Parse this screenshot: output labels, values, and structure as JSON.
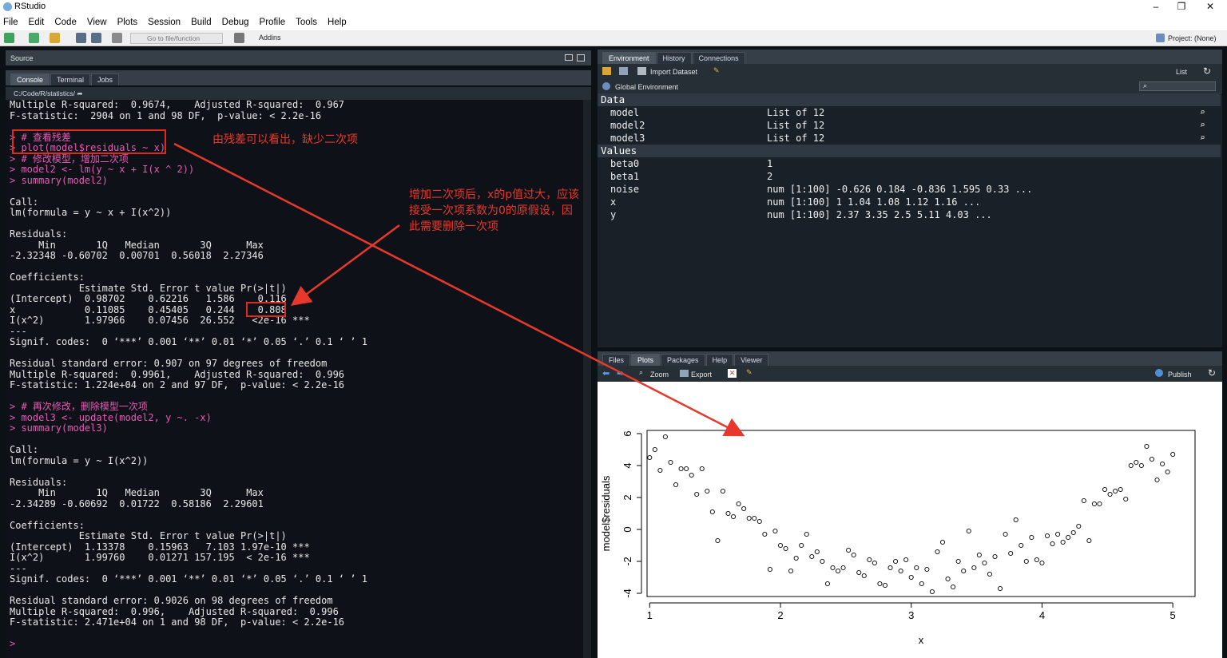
{
  "app": {
    "title": "RStudio"
  },
  "menu": [
    "File",
    "Edit",
    "Code",
    "View",
    "Plots",
    "Session",
    "Build",
    "Debug",
    "Profile",
    "Tools",
    "Help"
  ],
  "toolbar": {
    "goto": "Go to file/function",
    "addins": "Addins",
    "project": "Project: (None)"
  },
  "source": {
    "label": "Source"
  },
  "console_tabs": [
    "Console",
    "Terminal",
    "Jobs"
  ],
  "console_path": "C:/Code/R/statistics/",
  "console_lines": [
    {
      "t": "Multiple R-squared:  0.9674,\tAdjusted R-squared:  0.967 ",
      "c": "out"
    },
    {
      "t": "F-statistic:  2904 on 1 and 98 DF,  p-value: < 2.2e-16",
      "c": "out"
    },
    {
      "t": "",
      "c": "out"
    },
    {
      "t": "> # 查看残差",
      "c": "cmd"
    },
    {
      "t": "> plot(model$residuals ~ x)",
      "c": "cmd"
    },
    {
      "t": "> # 修改模型，增加二次项",
      "c": "cmd"
    },
    {
      "t": "> model2 <- lm(y ~ x + I(x ^ 2))",
      "c": "cmd"
    },
    {
      "t": "> summary(model2)",
      "c": "cmd"
    },
    {
      "t": "",
      "c": "out"
    },
    {
      "t": "Call:",
      "c": "out"
    },
    {
      "t": "lm(formula = y ~ x + I(x^2))",
      "c": "out"
    },
    {
      "t": "",
      "c": "out"
    },
    {
      "t": "Residuals:",
      "c": "out"
    },
    {
      "t": "     Min       1Q   Median       3Q      Max ",
      "c": "out"
    },
    {
      "t": "-2.32348 -0.60702  0.00701  0.56018  2.27346 ",
      "c": "out"
    },
    {
      "t": "",
      "c": "out"
    },
    {
      "t": "Coefficients:",
      "c": "out"
    },
    {
      "t": "            Estimate Std. Error t value Pr(>|t|)    ",
      "c": "out"
    },
    {
      "t": "(Intercept)  0.98702    0.62216   1.586    0.116    ",
      "c": "out"
    },
    {
      "t": "x            0.11085    0.45405   0.244    0.808    ",
      "c": "out"
    },
    {
      "t": "I(x^2)       1.97966    0.07456  26.552   <2e-16 ***",
      "c": "out"
    },
    {
      "t": "---",
      "c": "out"
    },
    {
      "t": "Signif. codes:  0 ‘***’ 0.001 ‘**’ 0.01 ‘*’ 0.05 ‘.’ 0.1 ‘ ’ 1",
      "c": "out"
    },
    {
      "t": "",
      "c": "out"
    },
    {
      "t": "Residual standard error: 0.907 on 97 degrees of freedom",
      "c": "out"
    },
    {
      "t": "Multiple R-squared:  0.9961,\tAdjusted R-squared:  0.996 ",
      "c": "out"
    },
    {
      "t": "F-statistic: 1.224e+04 on 2 and 97 DF,  p-value: < 2.2e-16",
      "c": "out"
    },
    {
      "t": "",
      "c": "out"
    },
    {
      "t": "> # 再次修改，删除模型一次项",
      "c": "cmd"
    },
    {
      "t": "> model3 <- update(model2, y ~. -x)",
      "c": "cmd"
    },
    {
      "t": "> summary(model3)",
      "c": "cmd"
    },
    {
      "t": "",
      "c": "out"
    },
    {
      "t": "Call:",
      "c": "out"
    },
    {
      "t": "lm(formula = y ~ I(x^2))",
      "c": "out"
    },
    {
      "t": "",
      "c": "out"
    },
    {
      "t": "Residuals:",
      "c": "out"
    },
    {
      "t": "     Min       1Q   Median       3Q      Max ",
      "c": "out"
    },
    {
      "t": "-2.34289 -0.60692  0.01722  0.58186  2.29601 ",
      "c": "out"
    },
    {
      "t": "",
      "c": "out"
    },
    {
      "t": "Coefficients:",
      "c": "out"
    },
    {
      "t": "            Estimate Std. Error t value Pr(>|t|)    ",
      "c": "out"
    },
    {
      "t": "(Intercept)  1.13378    0.15963   7.103 1.97e-10 ***",
      "c": "out"
    },
    {
      "t": "I(x^2)       1.99760    0.01271 157.195  < 2e-16 ***",
      "c": "out"
    },
    {
      "t": "---",
      "c": "out"
    },
    {
      "t": "Signif. codes:  0 ‘***’ 0.001 ‘**’ 0.01 ‘*’ 0.05 ‘.’ 0.1 ‘ ’ 1",
      "c": "out"
    },
    {
      "t": "",
      "c": "out"
    },
    {
      "t": "Residual standard error: 0.9026 on 98 degrees of freedom",
      "c": "out"
    },
    {
      "t": "Multiple R-squared:  0.996,\tAdjusted R-squared:  0.996 ",
      "c": "out"
    },
    {
      "t": "F-statistic: 2.471e+04 on 1 and 98 DF,  p-value: < 2.2e-16",
      "c": "out"
    },
    {
      "t": "",
      "c": "out"
    },
    {
      "t": "> ",
      "c": "cmd"
    }
  ],
  "annotations": {
    "note1": "由残差可以看出，缺少二次项",
    "note2": "增加二次项后，x的p值过大，应该接受一次项系数为0的原假设，因此需要删除一次项"
  },
  "env": {
    "tabs": [
      "Environment",
      "History",
      "Connections"
    ],
    "import": "Import Dataset",
    "list": "List",
    "global": "Global Environment",
    "data_header": "Data",
    "values_header": "Values",
    "data": [
      {
        "name": "model",
        "value": "List of 12"
      },
      {
        "name": "model2",
        "value": "List of 12"
      },
      {
        "name": "model3",
        "value": "List of 12"
      }
    ],
    "values": [
      {
        "name": "beta0",
        "value": "1"
      },
      {
        "name": "beta1",
        "value": "2"
      },
      {
        "name": "noise",
        "value": "num [1:100] -0.626 0.184 -0.836 1.595 0.33 ..."
      },
      {
        "name": "x",
        "value": "num [1:100] 1 1.04 1.08 1.12 1.16 ..."
      },
      {
        "name": "y",
        "value": "num [1:100] 2.37 3.35 2.5 5.11 4.03 ..."
      }
    ]
  },
  "files": {
    "tabs": [
      "Files",
      "Plots",
      "Packages",
      "Help",
      "Viewer"
    ],
    "zoom": "Zoom",
    "export": "Export",
    "publish": "Publish"
  },
  "chart_data": {
    "type": "scatter",
    "xlabel": "x",
    "ylabel": "model$residuals",
    "xlim": [
      0.98,
      5.17
    ],
    "ylim": [
      -4.2,
      6.2
    ],
    "xticks": [
      1,
      2,
      3,
      4,
      5
    ],
    "yticks": [
      -4,
      -2,
      0,
      2,
      4,
      6
    ],
    "x": [
      1,
      1.04,
      1.08,
      1.12,
      1.16,
      1.2,
      1.24,
      1.28,
      1.32,
      1.36,
      1.4,
      1.44,
      1.48,
      1.52,
      1.56,
      1.6,
      1.64,
      1.68,
      1.72,
      1.76,
      1.8,
      1.84,
      1.88,
      1.92,
      1.96,
      2,
      2.04,
      2.08,
      2.12,
      2.16,
      2.2,
      2.24,
      2.28,
      2.32,
      2.36,
      2.4,
      2.44,
      2.48,
      2.52,
      2.56,
      2.6,
      2.64,
      2.68,
      2.72,
      2.76,
      2.8,
      2.84,
      2.88,
      2.92,
      2.96,
      3,
      3.04,
      3.08,
      3.12,
      3.16,
      3.2,
      3.24,
      3.28,
      3.32,
      3.36,
      3.4,
      3.44,
      3.48,
      3.52,
      3.56,
      3.6,
      3.64,
      3.68,
      3.72,
      3.76,
      3.8,
      3.84,
      3.88,
      3.92,
      3.96,
      4,
      4.04,
      4.08,
      4.12,
      4.16,
      4.2,
      4.24,
      4.28,
      4.32,
      4.36,
      4.4,
      4.44,
      4.48,
      4.52,
      4.56,
      4.6,
      4.64,
      4.68,
      4.72,
      4.76,
      4.8,
      4.84,
      4.88,
      4.92,
      4.96,
      5
    ],
    "y": [
      4.5,
      5,
      3.7,
      5.8,
      4.2,
      2.8,
      3.8,
      3.8,
      3.4,
      2.2,
      3.8,
      2.4,
      1.1,
      -0.7,
      2.4,
      1,
      0.8,
      1.6,
      1.3,
      0.7,
      0.7,
      0.5,
      -0.3,
      -2.5,
      -0.1,
      -1,
      -1.2,
      -2.6,
      -1.8,
      -1,
      -0.3,
      -1.7,
      -1.4,
      -2,
      -3.4,
      -2.4,
      -2.6,
      -2.4,
      -1.3,
      -1.6,
      -2.7,
      -2.9,
      -1.9,
      -2.1,
      -3.4,
      -3.5,
      -2.4,
      -2,
      -2.6,
      -1.9,
      -3,
      -2.4,
      -3.4,
      -2.5,
      -3.9,
      -1.4,
      -0.8,
      -3.1,
      -3.6,
      -2,
      -2.6,
      -0.1,
      -2.4,
      -1.6,
      -2.1,
      -2.8,
      -1.7,
      -3.7,
      -0.3,
      -1.5,
      0.6,
      -1,
      -2,
      -0.5,
      -1.9,
      -2.1,
      -0.4,
      -0.9,
      -0.3,
      -0.8,
      -0.5,
      -0.2,
      0.2,
      1.8,
      -0.7,
      1.6,
      1.6,
      2.5,
      2.2,
      2.4,
      2.5,
      1.9,
      4,
      4.2,
      4,
      5.2,
      4.4,
      3.1,
      4.1,
      3.6,
      4.7
    ]
  }
}
